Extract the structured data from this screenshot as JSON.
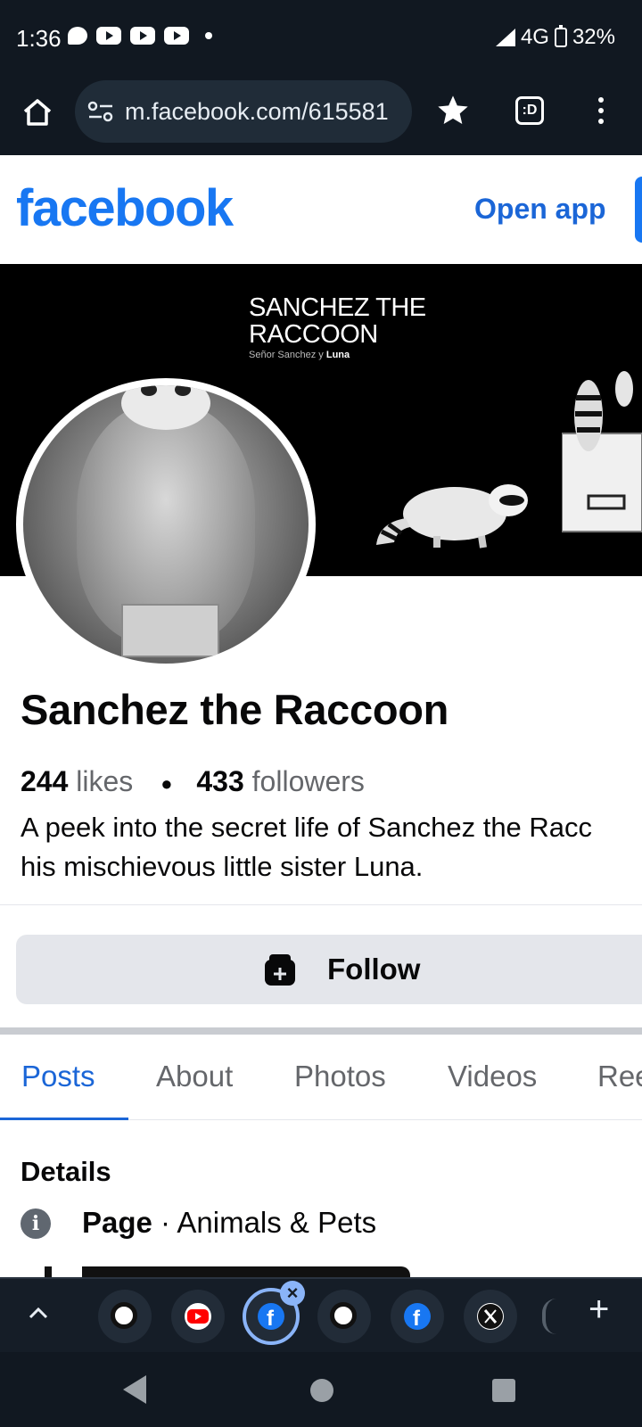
{
  "status_bar": {
    "time": "1:36",
    "network": "4G",
    "battery": "32%"
  },
  "browser": {
    "url": "m.facebook.com/615581",
    "tab_count_glyph": ":D"
  },
  "header": {
    "logo_text": "facebook",
    "open_app_label": "Open app",
    "brand_color": "#1877f2"
  },
  "cover": {
    "title_line1": "SANCHEZ THE",
    "title_line2": "RACCOON",
    "subtitle_prefix": "Señor Sanchez y ",
    "subtitle_bold": "Luna"
  },
  "page": {
    "name": "Sanchez the Raccoon",
    "likes_count": "244",
    "likes_label": "likes",
    "followers_count": "433",
    "followers_label": "followers",
    "bio_line1": "A peek into the secret life of Sanchez the Racc",
    "bio_line2": "his mischievous little sister Luna."
  },
  "actions": {
    "follow_label": "Follow"
  },
  "tabs": [
    {
      "label": "Posts",
      "active": true
    },
    {
      "label": "About",
      "active": false
    },
    {
      "label": "Photos",
      "active": false
    },
    {
      "label": "Videos",
      "active": false
    },
    {
      "label": "Ree",
      "active": false
    }
  ],
  "details": {
    "title": "Details",
    "page_label": "Page",
    "category": " · Animals & Pets"
  },
  "tab_strip": {
    "tabs": [
      "tiktok-icon",
      "youtube-icon",
      "facebook-icon",
      "tiktok-icon",
      "facebook-icon",
      "x-icon"
    ],
    "selected_index": 2
  }
}
